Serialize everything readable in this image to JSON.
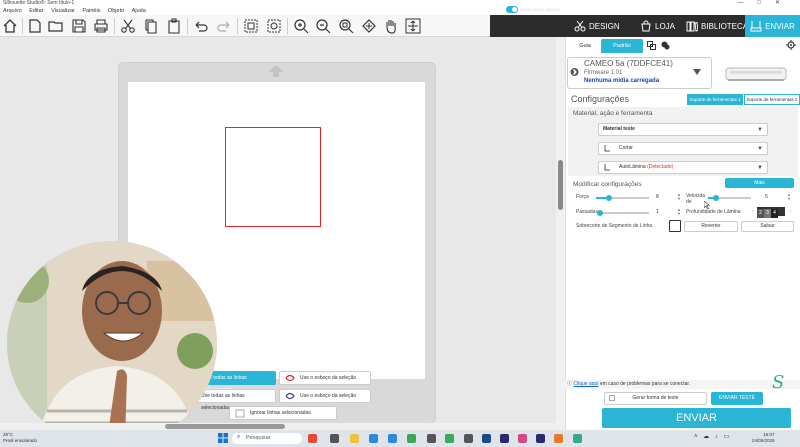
{
  "window": {
    "title": "Silhouette Studio®: Sem título-1",
    "controls": [
      "—",
      "□",
      "✕"
    ]
  },
  "menu": [
    "Arquivo",
    "Editar",
    "Visualizar",
    "Painéis",
    "Objeto",
    "Ajuda"
  ],
  "toolbar": {
    "start_mode_label": "Modo inicial ativado",
    "tabs": {
      "design": "DESIGN",
      "loja": "LOJA",
      "biblioteca": "BIBLIOTECA",
      "enviar": "ENVIAR"
    },
    "accent_color": "#2ab4d6"
  },
  "canvas": {
    "context_buttons": {
      "todas_linhas": "Use todas as linhas selecionadas",
      "esboco": "Use o esboço da seleção",
      "todas_linhas_2": "Use todas as linhas selecionadas",
      "esboco_2": "Use o esboço da seleção",
      "ignorar": "Ignorar linhas selecionadas"
    },
    "shape_color": "#e02a2a"
  },
  "panel": {
    "tabs": {
      "guia": "Guia",
      "padrao": "Padrão"
    },
    "device": {
      "name": "CAMEO 5a (7DDFCE41)",
      "firmware": "Firmware 1.01",
      "media": "Nenhuma mídia carregada"
    },
    "configuracoes": "Configurações",
    "suporte_1": "Suporte de ferramentas 1",
    "suporte_2": "Suporte de ferramentas 2",
    "material_section": "Material, ação e ferramenta",
    "material": "Material teste",
    "acao": "Cortar",
    "ferramenta": "AutoLâmina",
    "ferramenta_status": "(Detectado)",
    "modificar": "Modificar configurações",
    "mais": "Mais",
    "forca_label": "Força",
    "forca_value": "8",
    "velocidade_label": "Velocida de",
    "velocidade_value": "5",
    "passadas_label": "Passadas",
    "passadas_value": "1",
    "profundidade_label": "Profundidade de Lâmina",
    "profundidade_values": [
      "2",
      "3",
      "4"
    ],
    "sobrecorte_label": "Sobrecorte de Segmento de Linha",
    "reverter": "Reverter",
    "salvar": "Salvar",
    "help_link": "Clique aqui",
    "help_text": "em caso de problemas para se conectar.",
    "gerar_teste": "Gerar forma de teste",
    "enviar_teste": "ENVIAR TESTE",
    "enviar": "ENVIAR"
  },
  "taskbar": {
    "weather_temp": "28°C",
    "weather_desc": "Predi ensolarado",
    "search_placeholder": "Pesquisar",
    "time": "15:07",
    "date": "24/05/2026"
  }
}
